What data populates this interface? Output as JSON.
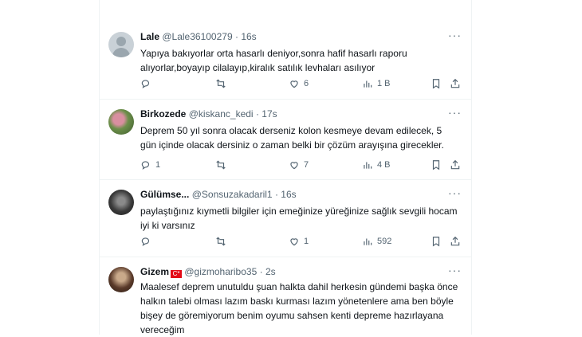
{
  "tweets": [
    {
      "name": "Lale",
      "handle": "@Lale36100279",
      "time": "16s",
      "text": "Yapıya bakıyorlar orta hasarlı deniyor,sonra hafif hasarlı raporu alıyorlar,boyayıp cilalayıp,kiralık satılık levhaları asılıyor",
      "reply_count": "",
      "retweet_count": "",
      "like_count": "6",
      "view_count": "1 B",
      "avatar_icon": "default-avatar-icon"
    },
    {
      "name": "Birkozede",
      "handle": "@kiskanc_kedi",
      "time": "17s",
      "text": "Deprem 50 yıl sonra olacak derseniz kolon kesmeye devam edilecek, 5 gün içinde olacak dersiniz o zaman belki bir çözüm arayışına girecekler.",
      "reply_count": "1",
      "retweet_count": "",
      "like_count": "7",
      "view_count": "4 B",
      "avatar_icon": "flower-avatar-icon"
    },
    {
      "name": "Gülümse...",
      "handle": "@Sonsuzakadaril1",
      "time": "16s",
      "text": "paylaştığınız kıymetli bilgiler için emeğinize yüreğinize sağlık sevgili hocam iyi ki varsınız",
      "reply_count": "",
      "retweet_count": "",
      "like_count": "1",
      "view_count": "592",
      "avatar_icon": "portrait-avatar-icon"
    },
    {
      "name": "Gizem",
      "flag": "C*",
      "handle": "@gizmoharibo35",
      "time": "2s",
      "text": "Maalesef deprem unutuldu şuan halkta dahil herkesin gündemi başka önce halkın talebi olması lazım baskı kurması lazım yönetenlere ama ben böyle bişey de göremiyorum benim oyumu sahsen kenti depreme hazırlayana vereceğim",
      "avatar_icon": "portrait-avatar-icon"
    }
  ],
  "more_label": "···",
  "dot": "·",
  "colors": {
    "text": "#0f1419",
    "muted": "#536471",
    "border": "#eff3f4",
    "flag": "#e30a17"
  }
}
